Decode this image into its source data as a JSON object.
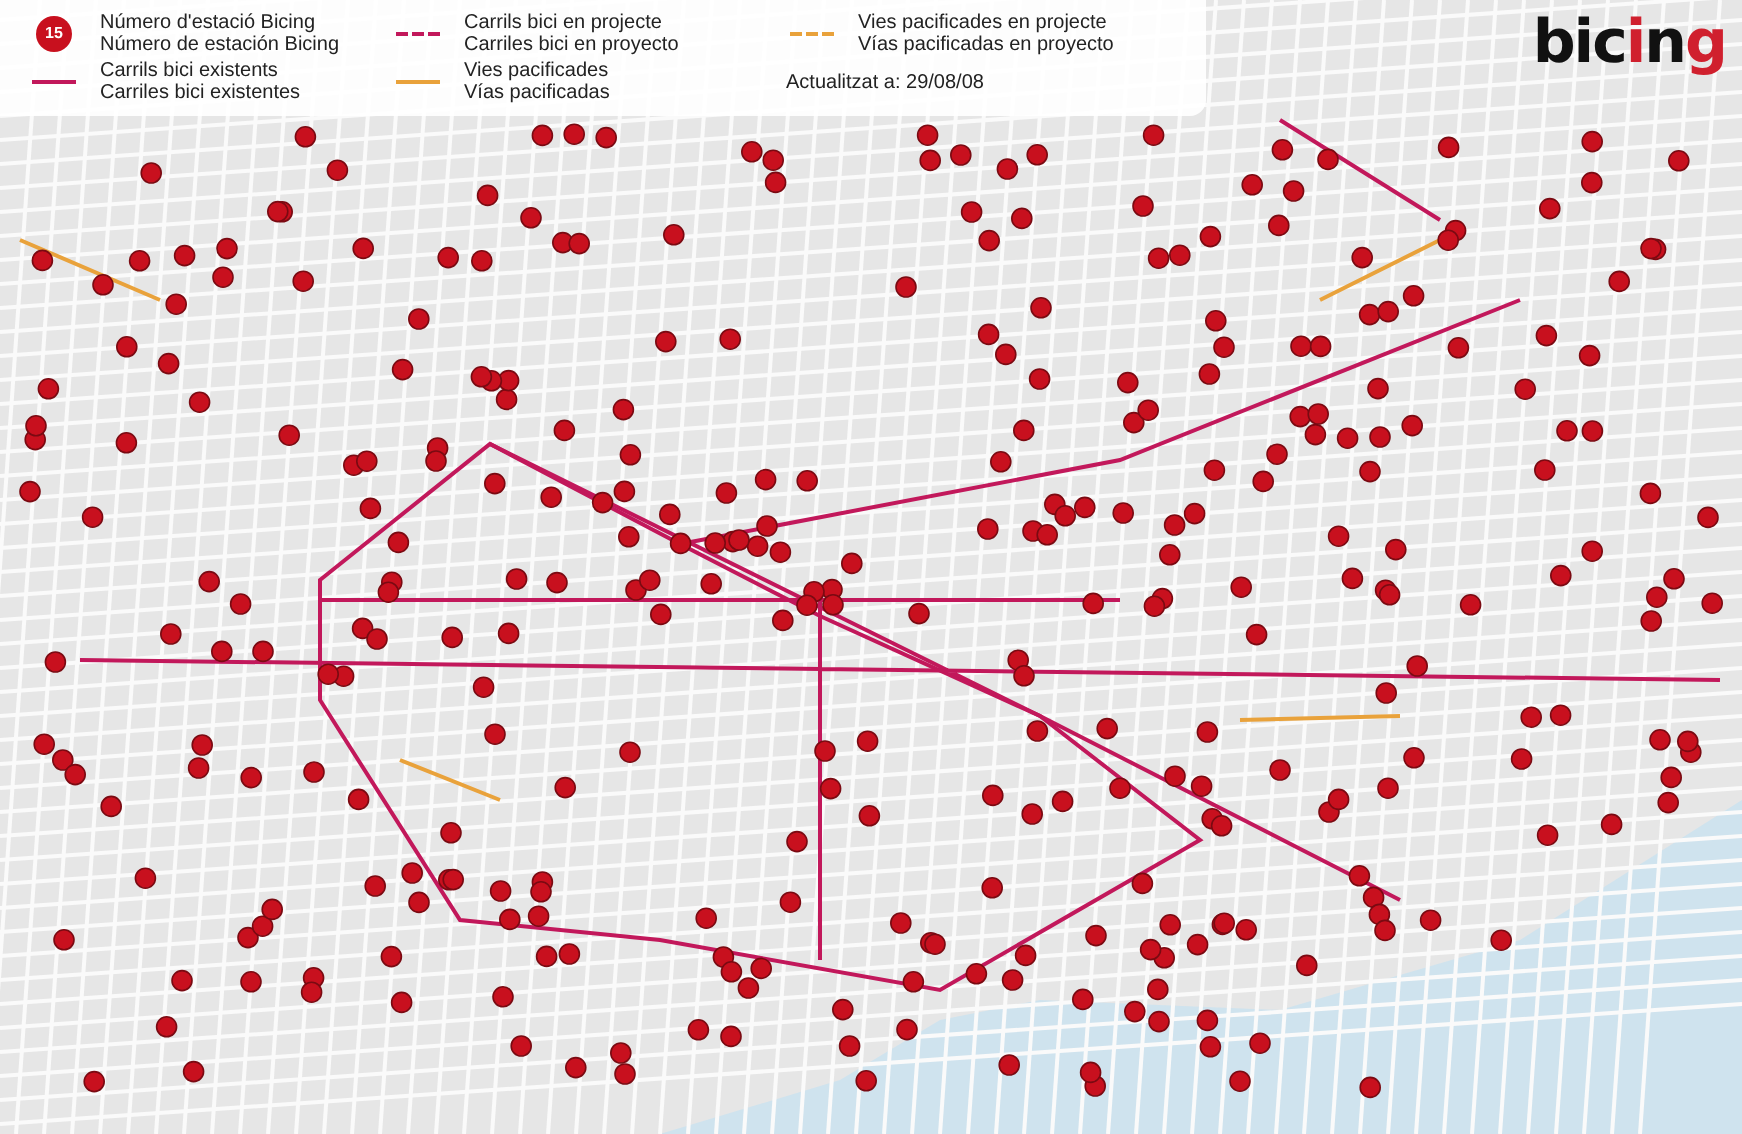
{
  "legend": {
    "items": [
      {
        "kind": "station",
        "badge": "15",
        "labels": [
          "Número d'estació Bicing",
          "Número de estación Bicing"
        ]
      },
      {
        "kind": "line",
        "color": "#c2185b",
        "dashed": true,
        "labels": [
          "Carrils bici en projecte",
          "Carriles bici en proyecto"
        ]
      },
      {
        "kind": "line",
        "color": "#e9a23b",
        "dashed": true,
        "labels": [
          "Vies pacificades en projecte",
          "Vías pacificadas en proyecto"
        ]
      },
      {
        "kind": "line",
        "color": "#c2185b",
        "dashed": false,
        "labels": [
          "Carrils bici existents",
          "Carriles bici existentes"
        ]
      },
      {
        "kind": "line",
        "color": "#e9a23b",
        "dashed": false,
        "labels": [
          "Vies pacificades",
          "Vías pacificadas"
        ]
      },
      {
        "kind": "note",
        "labels": [
          "Actualitzat a: 29/08/08"
        ]
      }
    ]
  },
  "logo": {
    "parts": [
      {
        "text": "bic",
        "color": "#111111"
      },
      {
        "text": "i",
        "color": "#d0202e"
      },
      {
        "text": "n",
        "color": "#111111"
      },
      {
        "text": "g",
        "color": "#d0202e"
      }
    ]
  }
}
